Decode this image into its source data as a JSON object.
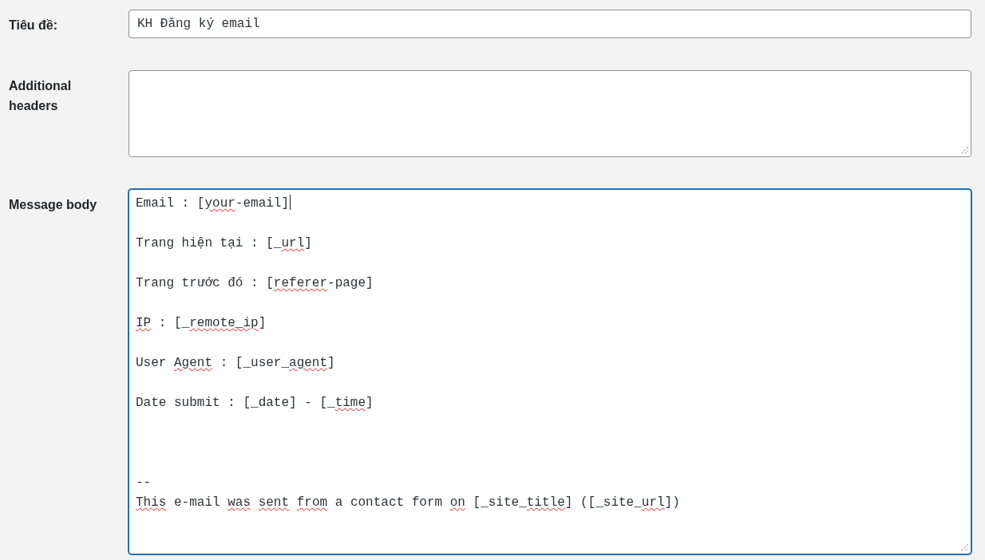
{
  "fields": [
    {
      "kind": "input",
      "label": "Tiêu đề:",
      "value": "KH Đăng ký email",
      "focused": false
    },
    {
      "kind": "textarea",
      "label": "Additional headers",
      "focused": false
    },
    {
      "kind": "textarea",
      "label": "Message body",
      "focused": true,
      "lines": [
        {
          "kind": "text",
          "has_cursor": true,
          "segments": [
            {
              "text": "Email : [",
              "misspelled": false
            },
            {
              "text": "your",
              "misspelled": true
            },
            {
              "text": "-email]",
              "misspelled": false
            }
          ]
        },
        {
          "kind": "blank"
        },
        {
          "kind": "text",
          "has_cursor": false,
          "segments": [
            {
              "text": "Trang hiện tại : [_",
              "misspelled": false
            },
            {
              "text": "url",
              "misspelled": true
            },
            {
              "text": "]",
              "misspelled": false
            }
          ]
        },
        {
          "kind": "blank"
        },
        {
          "kind": "text",
          "has_cursor": false,
          "segments": [
            {
              "text": "Trang trước đó : [",
              "misspelled": false
            },
            {
              "text": "referer",
              "misspelled": true
            },
            {
              "text": "-page]",
              "misspelled": false
            }
          ]
        },
        {
          "kind": "blank"
        },
        {
          "kind": "text",
          "has_cursor": false,
          "segments": [
            {
              "text": "IP",
              "misspelled": true
            },
            {
              "text": " : [_",
              "misspelled": false
            },
            {
              "text": "remote_ip",
              "misspelled": true
            },
            {
              "text": "]",
              "misspelled": false
            }
          ]
        },
        {
          "kind": "blank"
        },
        {
          "kind": "text",
          "has_cursor": false,
          "segments": [
            {
              "text": "User ",
              "misspelled": false
            },
            {
              "text": "Agent",
              "misspelled": true
            },
            {
              "text": " : [_user_",
              "misspelled": false
            },
            {
              "text": "agent",
              "misspelled": true
            },
            {
              "text": "]",
              "misspelled": false
            }
          ]
        },
        {
          "kind": "blank"
        },
        {
          "kind": "text",
          "has_cursor": false,
          "segments": [
            {
              "text": "Date submit : [_date] - [_",
              "misspelled": false
            },
            {
              "text": "time",
              "misspelled": true
            },
            {
              "text": "]",
              "misspelled": false
            }
          ]
        },
        {
          "kind": "blank"
        },
        {
          "kind": "blank"
        },
        {
          "kind": "blank"
        },
        {
          "kind": "text",
          "has_cursor": false,
          "segments": [
            {
              "text": "--",
              "misspelled": false
            }
          ]
        },
        {
          "kind": "text",
          "has_cursor": false,
          "segments": [
            {
              "text": "This ",
              "misspelled": true
            },
            {
              "text": "e-mail ",
              "misspelled": false
            },
            {
              "text": "was ",
              "misspelled": true
            },
            {
              "text": "sent ",
              "misspelled": true
            },
            {
              "text": "from ",
              "misspelled": true
            },
            {
              "text": "a contact form ",
              "misspelled": false
            },
            {
              "text": "on ",
              "misspelled": true
            },
            {
              "text": "[_site_",
              "misspelled": false
            },
            {
              "text": "title",
              "misspelled": true
            },
            {
              "text": "] ([_site_",
              "misspelled": false
            },
            {
              "text": "url",
              "misspelled": true
            },
            {
              "text": "])",
              "misspelled": false
            }
          ]
        }
      ]
    }
  ]
}
